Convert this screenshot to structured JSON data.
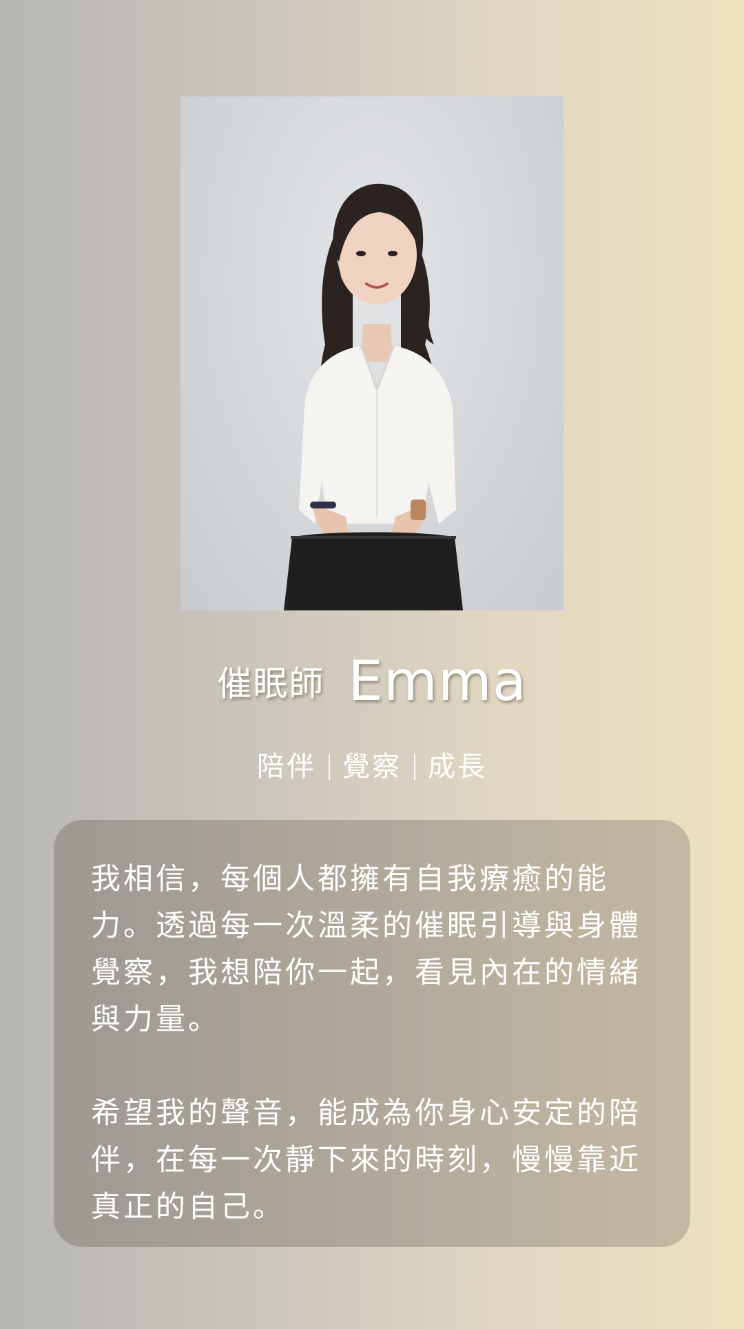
{
  "profile": {
    "role": "催眠師",
    "name": "Emma",
    "tags": [
      "陪伴",
      "覺察",
      "成長"
    ]
  },
  "quote": {
    "paragraph1": "我相信，每個人都擁有自我療癒的能力。透過每一次溫柔的催眠引導與身體覺察，我想陪你一起，看見內在的情緒與力量。",
    "paragraph2": "希望我的聲音，能成為你身心安定的陪伴，在每一次靜下來的時刻，慢慢靠近真正的自己。"
  },
  "colors": {
    "background_left": "#b7b6b4",
    "background_right": "#eee1bf",
    "text": "#ffffff",
    "card": "#a59e92"
  }
}
